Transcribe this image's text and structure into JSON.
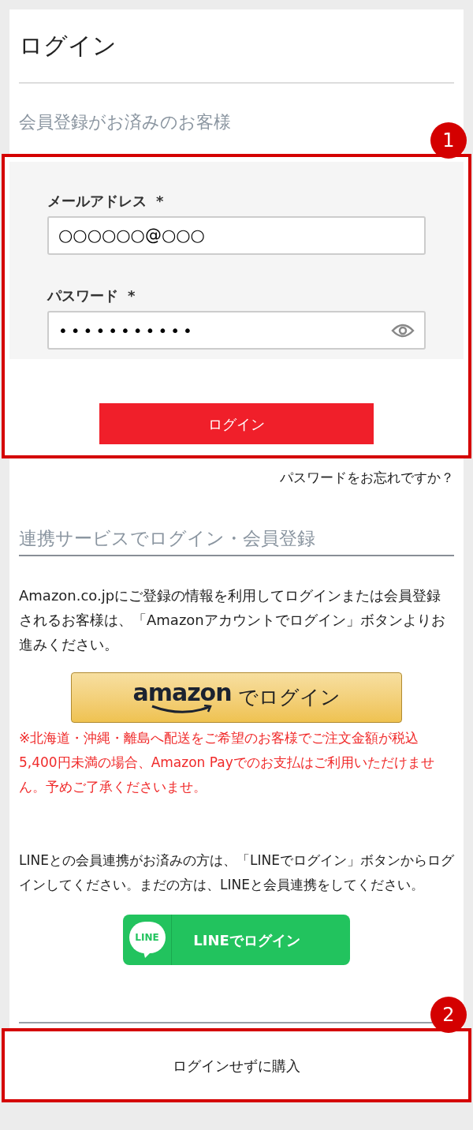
{
  "title": "ログイン",
  "member_section": {
    "heading": "会員登録がお済みのお客様",
    "annotation": "1",
    "fields": [
      {
        "label": "メールアドレス",
        "required_mark": "*",
        "kind": "text",
        "value": "○○○○○○@○○○"
      },
      {
        "label": "パスワード",
        "required_mark": "*",
        "kind": "password",
        "value": "•••••••••••"
      }
    ],
    "login_button": "ログイン"
  },
  "forgot_password_link": "パスワードをお忘れですか？",
  "linked_section": {
    "heading": "連携サービスでログイン・会員登録",
    "amazon_text": "Amazon.co.jpにご登録の情報を利用してログインまたは会員登録されるお客様は、「Amazonアカウントでログイン」ボタンよりお進みください。",
    "amazon_button": {
      "logo": "amazon",
      "label": "でログイン"
    },
    "amazon_note": "※北海道・沖縄・離島へ配送をご希望のお客様でご注文金額が税込5,400円未満の場合、Amazon Payでのお支払はご利用いただけません。予めご了承くださいませ。",
    "line_text": "LINEとの会員連携がお済みの方は、「LINEでログイン」ボタンからログインしてください。まだの方は、LINEと会員連携をしてください。",
    "line_button": {
      "logo": "LINE",
      "label": "LINEでログイン"
    }
  },
  "guest_section": {
    "annotation": "2",
    "button": "ログインせずに購入"
  }
}
